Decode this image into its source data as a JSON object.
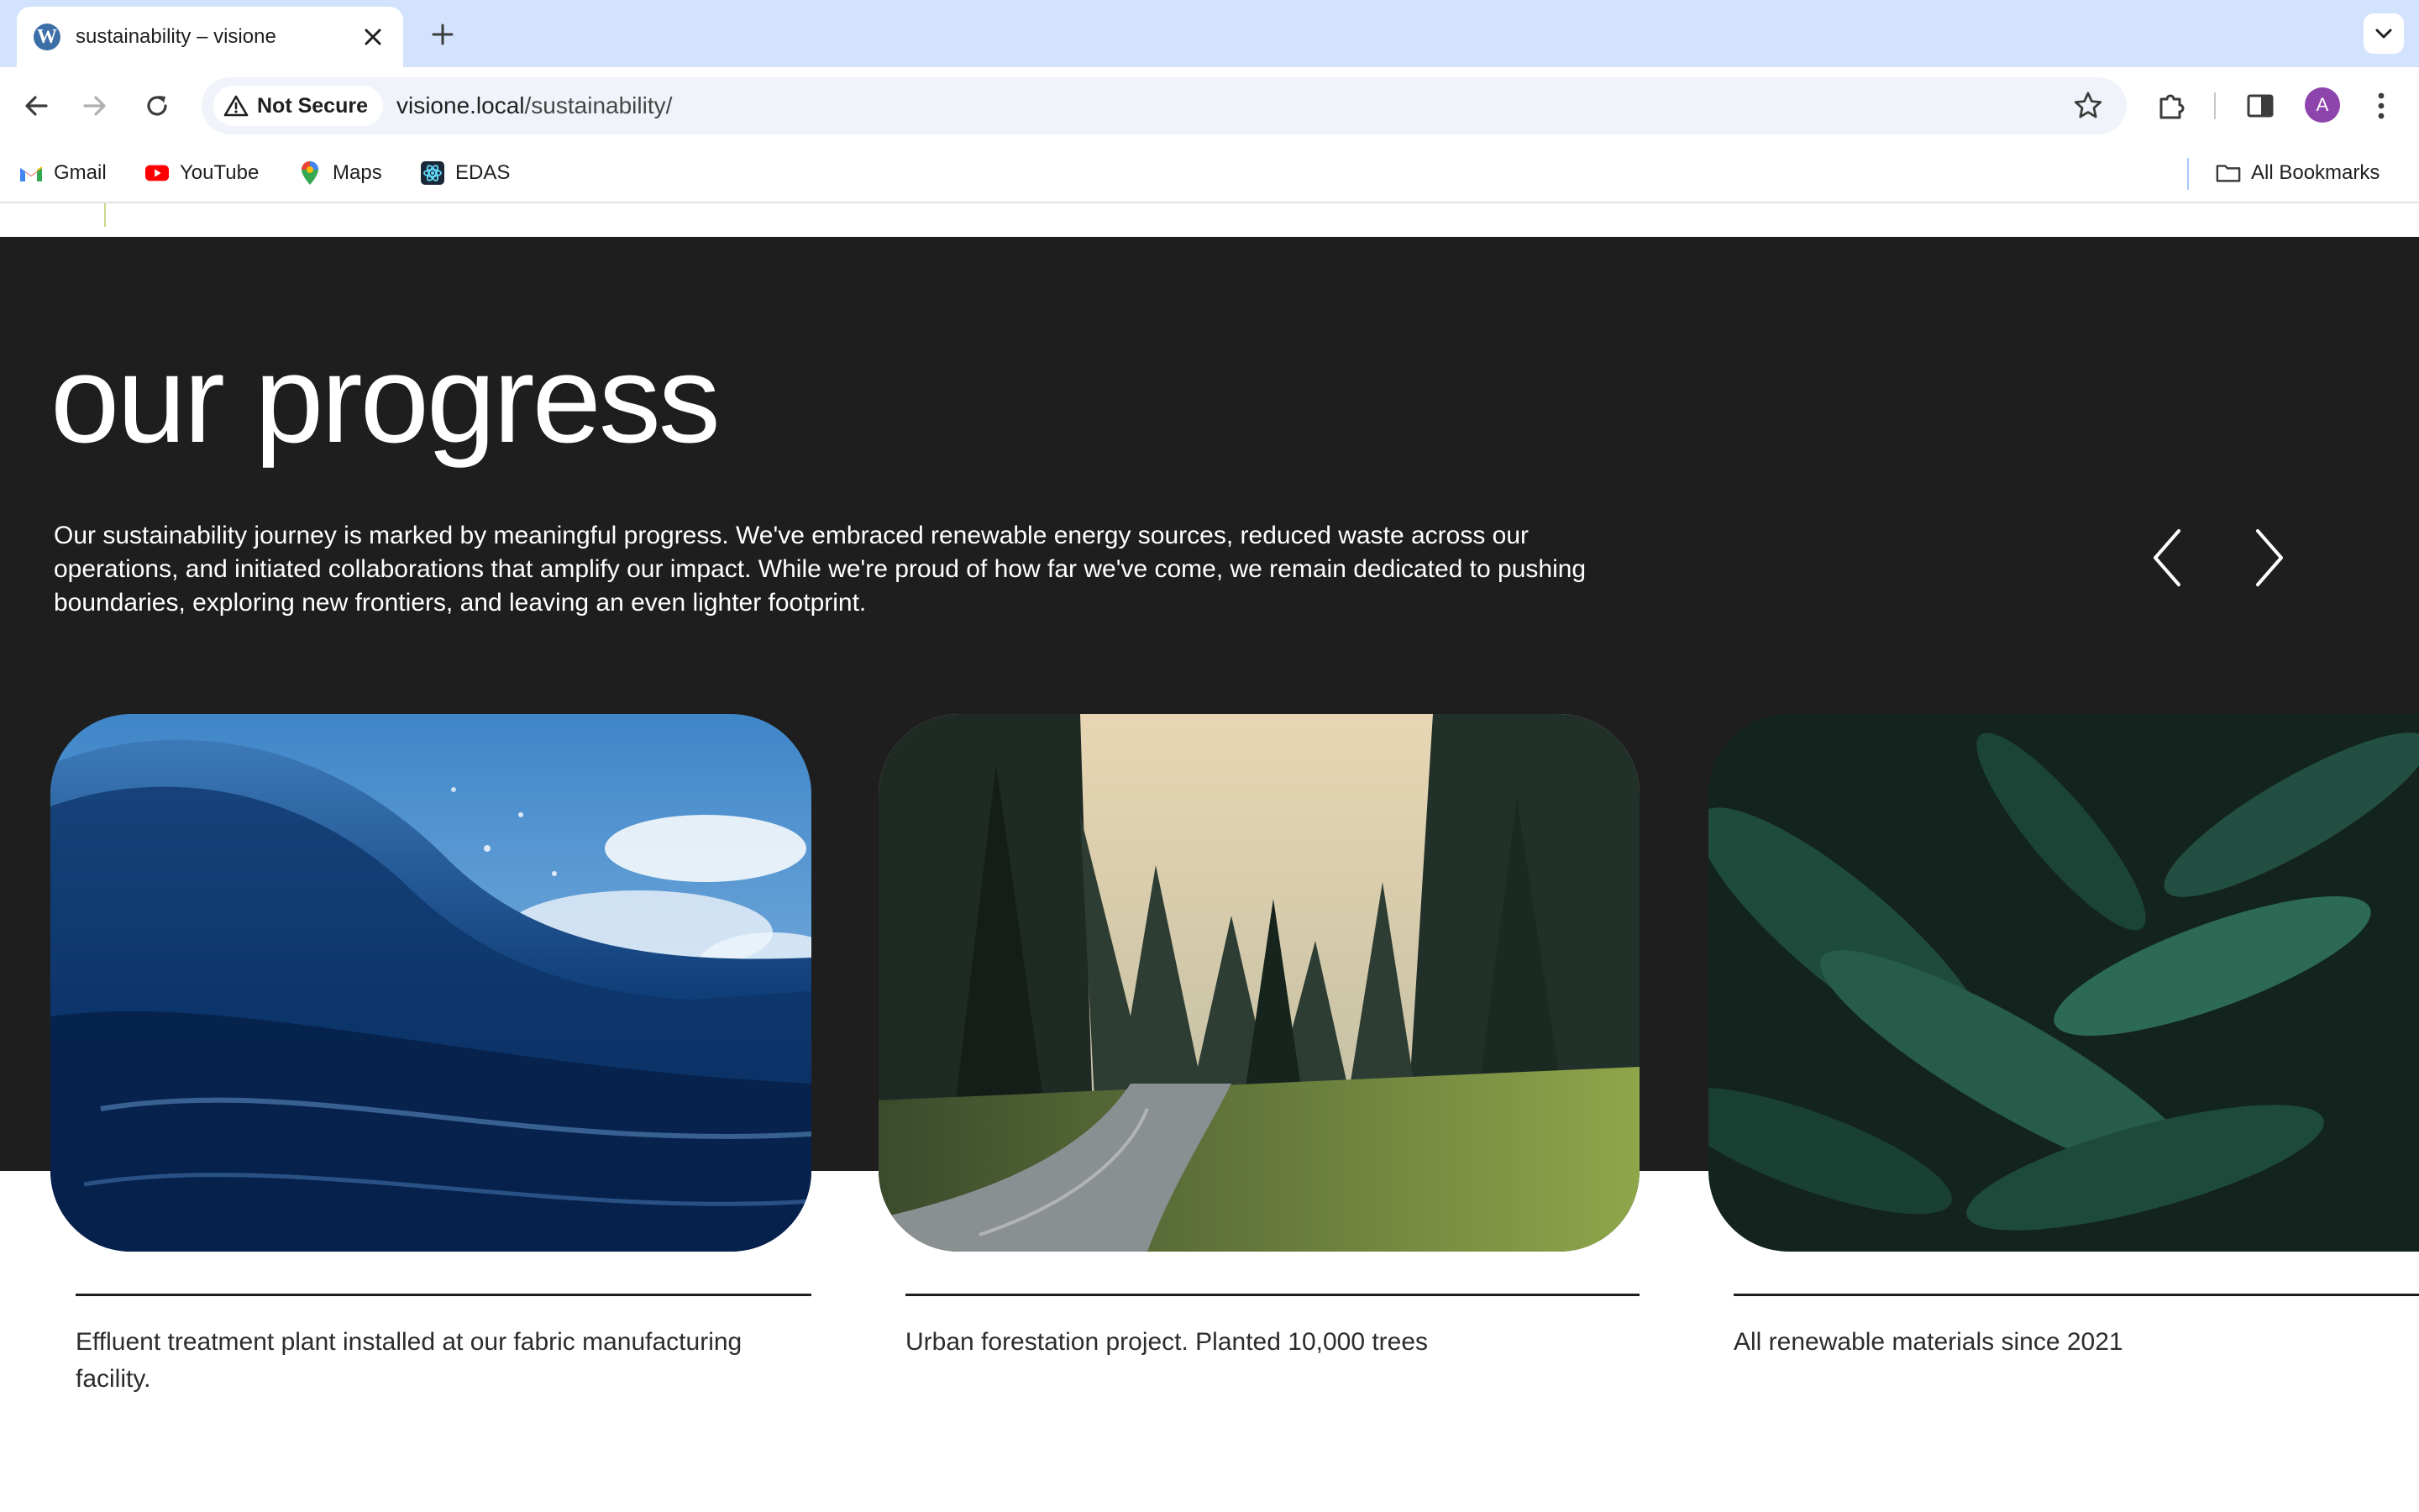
{
  "browser": {
    "tab": {
      "title": "sustainability – visione",
      "favicon": "wordpress-icon"
    },
    "new_tab_label": "+",
    "security_label": "Not Secure",
    "url_host": "visione.local",
    "url_path": "/sustainability/",
    "avatar_letter": "A",
    "bookmarks": [
      {
        "label": "Gmail",
        "icon": "gmail-icon"
      },
      {
        "label": "YouTube",
        "icon": "youtube-icon"
      },
      {
        "label": "Maps",
        "icon": "maps-icon"
      },
      {
        "label": "EDAS",
        "icon": "edas-icon"
      }
    ],
    "all_bookmarks_label": "All Bookmarks"
  },
  "hero": {
    "title": "our progress",
    "description": "Our sustainability journey is marked by meaningful progress. We've embraced renewable energy sources, reduced waste across our operations, and initiated collaborations that amplify our impact. While we're proud of how far we've come, we remain dedicated to pushing boundaries, exploring new frontiers, and leaving an even lighter footprint."
  },
  "cards": [
    {
      "caption": "Effluent treatment plant installed at our fabric manufacturing facility.",
      "image": "ocean-wave-photo"
    },
    {
      "caption": "Urban forestation project. Planted 10,000 trees",
      "image": "forest-river-photo"
    },
    {
      "caption": "All renewable materials since 2021",
      "image": "green-leaves-photo"
    }
  ],
  "colors": {
    "hero_background": "#1e1e1e",
    "tab_strip": "#d3e3fd",
    "omnibox": "#f0f3f9"
  }
}
